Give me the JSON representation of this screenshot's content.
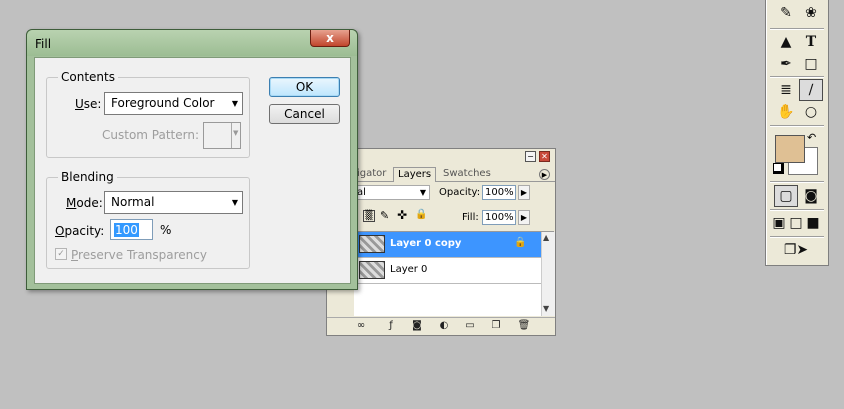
{
  "fill_dialog": {
    "title": "Fill",
    "close_label": "x",
    "contents_group": "Contents",
    "use_label_u": "U",
    "use_label_rest": "se:",
    "use_value": "Foreground Color",
    "custom_pattern_label": "Custom Pattern:",
    "blending_group": "Blending",
    "mode_label_m": "M",
    "mode_label_rest": "ode:",
    "mode_value": "Normal",
    "opacity_label_o": "O",
    "opacity_label_rest": "pacity:",
    "opacity_value": "100",
    "opacity_unit": "%",
    "preserve_p": "P",
    "preserve_rest": "reserve Transparency",
    "ok_label": "OK",
    "cancel_label": "Cancel"
  },
  "layers_palette": {
    "tabs": [
      "igator",
      "Layers",
      "Swatches"
    ],
    "blend_mode_partial": "al",
    "opacity_label": "Opacity:",
    "opacity_value": "100%",
    "fill_label": "Fill:",
    "fill_value": "100%",
    "layers": [
      {
        "name": "Layer 0 copy",
        "selected": true,
        "locked": true
      },
      {
        "name": "Layer 0",
        "selected": false,
        "locked": false
      }
    ]
  },
  "toolbox": {
    "foreground_color": "#dfc094",
    "background_color": "#ffffff"
  },
  "colors": {
    "desktop": "#c0c0c0",
    "selection": "#3d95ff",
    "dialog_frame": "#a3c09b"
  }
}
